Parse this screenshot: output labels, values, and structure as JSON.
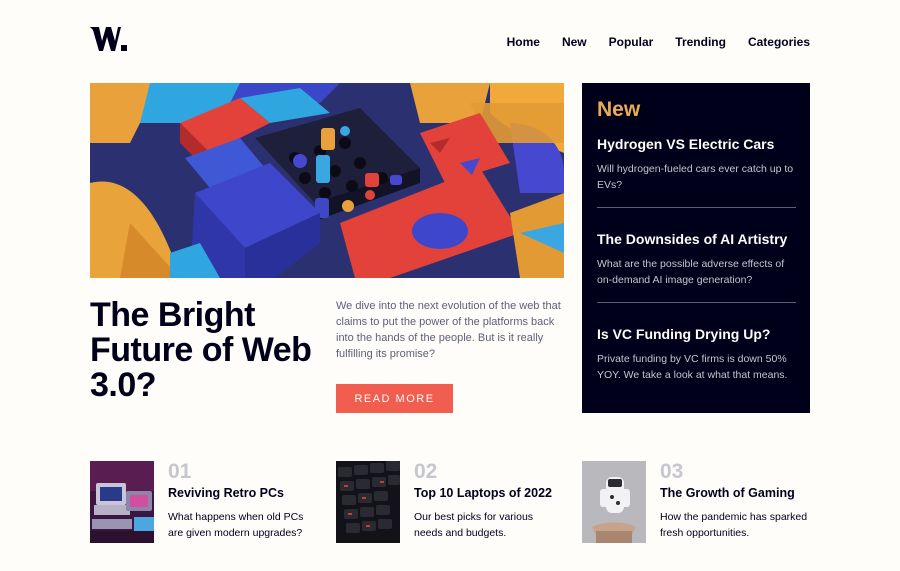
{
  "brand": {
    "logo_text": "W."
  },
  "nav": {
    "items": [
      {
        "label": "Home"
      },
      {
        "label": "New"
      },
      {
        "label": "Popular"
      },
      {
        "label": "Trending"
      },
      {
        "label": "Categories"
      }
    ]
  },
  "hero": {
    "headline": "The Bright Future of Web 3.0?",
    "intro": "We dive into the next evolution of the web that claims to put the power of the platforms back into the hands of the people. But is it really fulfilling its promise?",
    "button_label": "READ MORE"
  },
  "new_panel": {
    "title": "New",
    "items": [
      {
        "title": "Hydrogen VS Electric Cars",
        "desc": "Will hydrogen-fueled cars ever catch up to EVs?"
      },
      {
        "title": "The Downsides of AI Artistry",
        "desc": "What are the possible adverse effects of on-demand AI image generation?"
      },
      {
        "title": "Is VC Funding Drying Up?",
        "desc": "Private funding by VC firms is down 50% YOY. We take a look at what that means."
      }
    ]
  },
  "articles": [
    {
      "num": "01",
      "title": "Reviving Retro PCs",
      "desc": "What happens when old PCs are given modern upgrades?"
    },
    {
      "num": "02",
      "title": "Top 10 Laptops of 2022",
      "desc": "Our best picks for various needs and budgets."
    },
    {
      "num": "03",
      "title": "The Growth of Gaming",
      "desc": "How the pandemic has sparked fresh opportunities."
    }
  ],
  "colors": {
    "accent_red": "#f15e50",
    "accent_orange": "#e9ab53",
    "dark_navy": "#00001a",
    "muted_gray": "#5d5f79",
    "light_gray": "#c5c6ce",
    "background": "#fffdfa"
  }
}
